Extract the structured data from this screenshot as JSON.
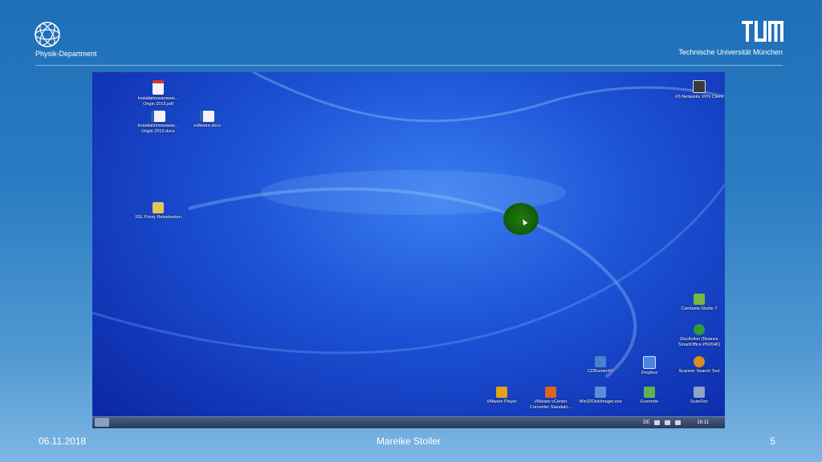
{
  "header": {
    "department": "Physik-Department",
    "university": "Technische Universität München"
  },
  "desktop": {
    "icons_left": [
      {
        "label": "Installationsanweis... Origin 2015.pdf",
        "icon": "pdf-file-icon",
        "color": "#d9362b"
      },
      {
        "label": "Installationsanweis... Origin 2015.docx",
        "icon": "word-file-icon",
        "color": "#2b5fb8"
      },
      {
        "label": "software.docx",
        "icon": "word-file-icon",
        "color": "#2b5fb8"
      },
      {
        "label": "SSL Proxy Reisekosten",
        "icon": "folder-icon",
        "color": "#e8c25a"
      }
    ],
    "icons_right": [
      {
        "label": "F5 Networks VPN Client",
        "icon": "vpn-app-icon",
        "color": "#3a3a3a"
      },
      {
        "label": "Camtasia Studio 7",
        "icon": "camtasia-icon",
        "color": "#79b63c"
      },
      {
        "label": "DocAction (Nuance SmartOffice PN2040)",
        "icon": "docaction-icon",
        "color": "#2f9a3a"
      },
      {
        "label": "CDBurnerXP",
        "icon": "cdburner-icon",
        "color": "#4a7fd1"
      },
      {
        "label": "Dropbox",
        "icon": "dropbox-icon",
        "color": "#4a86e0"
      },
      {
        "label": "Scanner Search Tool",
        "icon": "scanner-search-icon",
        "color": "#e08a1c"
      },
      {
        "label": "VMware Player",
        "icon": "vmware-player-icon",
        "color": "#e3a21a"
      },
      {
        "label": "VMware vCenter Converter Standalo...",
        "icon": "vmware-converter-icon",
        "color": "#d9661e"
      },
      {
        "label": "Win32DiskImager.exe",
        "icon": "disk-imager-icon",
        "color": "#5a8ed8"
      },
      {
        "label": "Evernote",
        "icon": "evernote-icon",
        "color": "#5bb34a"
      },
      {
        "label": "ScanDoc",
        "icon": "scandoc-icon",
        "color": "#8fa3c6"
      }
    ]
  },
  "taskbar": {
    "language": "DE",
    "clock": "16:11"
  },
  "footer": {
    "date": "06.11.2018",
    "author": "Mareike Stoller",
    "page": "5"
  }
}
